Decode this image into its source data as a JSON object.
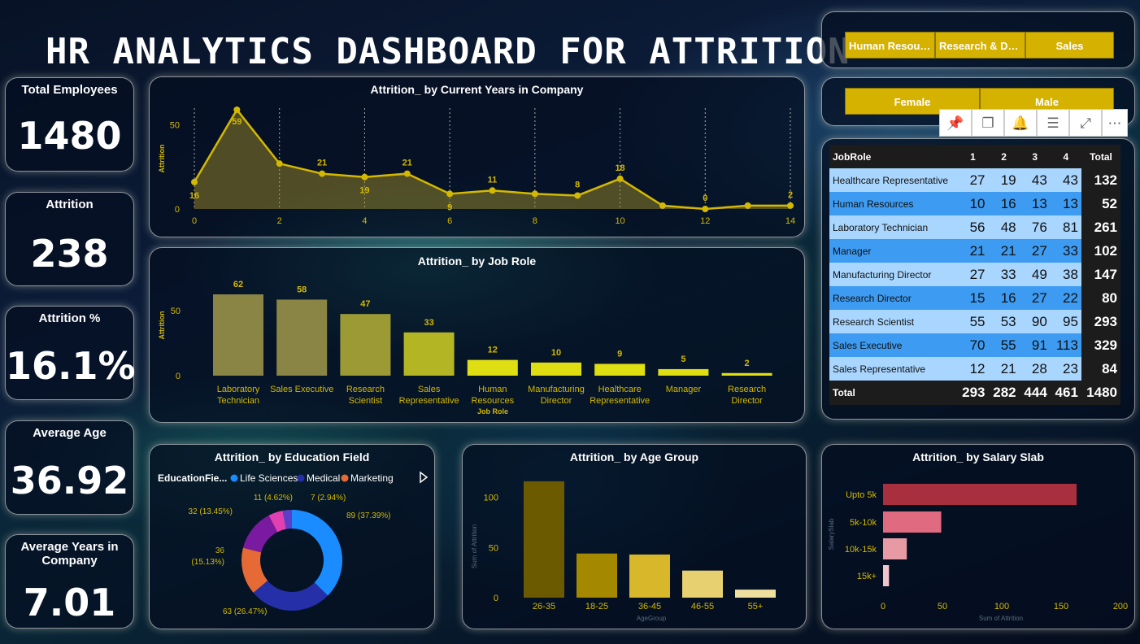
{
  "title": "HR ANALYTICS DASHBOARD FOR ATTRITION",
  "kpis": {
    "total_employees": {
      "label": "Total Employees",
      "value": "1480"
    },
    "attrition": {
      "label": "Attrition",
      "value": "238"
    },
    "attrition_pct": {
      "label": "Attrition %",
      "value": "16.1%"
    },
    "average_age": {
      "label": "Average Age",
      "value": "36.92"
    },
    "average_years": {
      "label": "Average Years in Company",
      "value": "7.01"
    }
  },
  "slicers": {
    "department": [
      "Human Resour...",
      "Research & De...",
      "Sales"
    ],
    "gender": [
      "Female",
      "Male"
    ]
  },
  "toolbar_icons": [
    "pin-icon",
    "copy-icon",
    "bell-icon",
    "filter-icon",
    "expand-icon",
    "more-icon"
  ],
  "colors": {
    "gold": "#d6b200",
    "line": "#d4b800",
    "bar_olive": "#8a8640",
    "bar_yellow": "#dede10",
    "donut_blue": "#1a8cff",
    "donut_navy": "#2530a8",
    "donut_orange": "#e56a35",
    "donut_purple": "#7a1aa0",
    "donut_pink": "#e040b0",
    "salary": "#c03848"
  },
  "matrix": {
    "headers": [
      "JobRole",
      "1",
      "2",
      "3",
      "4",
      "Total"
    ],
    "rows": [
      {
        "role": "Healthcare Representative",
        "v": [
          "27",
          "19",
          "43",
          "43"
        ],
        "total": "132"
      },
      {
        "role": "Human Resources",
        "v": [
          "10",
          "16",
          "13",
          "13"
        ],
        "total": "52"
      },
      {
        "role": "Laboratory Technician",
        "v": [
          "56",
          "48",
          "76",
          "81"
        ],
        "total": "261"
      },
      {
        "role": "Manager",
        "v": [
          "21",
          "21",
          "27",
          "33"
        ],
        "total": "102"
      },
      {
        "role": "Manufacturing Director",
        "v": [
          "27",
          "33",
          "49",
          "38"
        ],
        "total": "147"
      },
      {
        "role": "Research Director",
        "v": [
          "15",
          "16",
          "27",
          "22"
        ],
        "total": "80"
      },
      {
        "role": "Research Scientist",
        "v": [
          "55",
          "53",
          "90",
          "95"
        ],
        "total": "293"
      },
      {
        "role": "Sales Executive",
        "v": [
          "70",
          "55",
          "91",
          "113"
        ],
        "total": "329"
      },
      {
        "role": "Sales Representative",
        "v": [
          "12",
          "21",
          "28",
          "23"
        ],
        "total": "84"
      }
    ],
    "total_row": {
      "label": "Total",
      "v": [
        "293",
        "282",
        "444",
        "461"
      ],
      "total": "1480"
    }
  },
  "chart_data": [
    {
      "id": "years",
      "type": "area",
      "title": "Attrition_ by Current Years in Company",
      "ylabel": "Attrition",
      "x": [
        0,
        1,
        2,
        3,
        4,
        5,
        6,
        7,
        8,
        9,
        10,
        11,
        12,
        13,
        14
      ],
      "values": [
        16,
        59,
        27,
        21,
        19,
        21,
        9,
        11,
        9,
        8,
        18,
        2,
        0,
        2,
        2
      ],
      "data_labels": [
        {
          "i": 0,
          "text": "16"
        },
        {
          "i": 1,
          "text": "59"
        },
        {
          "i": 3,
          "text": "21"
        },
        {
          "i": 4,
          "text": "19"
        },
        {
          "i": 5,
          "text": "21"
        },
        {
          "i": 6,
          "text": "9"
        },
        {
          "i": 7,
          "text": "11"
        },
        {
          "i": 9,
          "text": "8"
        },
        {
          "i": 10,
          "text": "18"
        },
        {
          "i": 12,
          "text": "0"
        },
        {
          "i": 14,
          "text": "2"
        }
      ],
      "x_ticks": [
        "0",
        "2",
        "4",
        "6",
        "8",
        "10",
        "12",
        "14"
      ],
      "y_ticks": [
        "0",
        "50"
      ],
      "ylim": [
        0,
        59
      ]
    },
    {
      "id": "jobrole",
      "type": "bar",
      "title": "Attrition_ by Job Role",
      "ylabel": "Attrition",
      "xlabel": "Job Role",
      "categories": [
        "Laboratory Technician",
        "Sales Executive",
        "Research Scientist",
        "Sales Representative",
        "Human Resources",
        "Manufacturing Director",
        "Healthcare Representative",
        "Manager",
        "Research Director"
      ],
      "values": [
        62,
        58,
        47,
        33,
        12,
        10,
        9,
        5,
        2
      ],
      "y_ticks": [
        "0",
        "50"
      ],
      "ylim": [
        0,
        62
      ]
    },
    {
      "id": "education",
      "type": "pie",
      "title": "Attrition_ by Education Field",
      "legend_title": "EducationFie...",
      "legend": [
        "Life Sciences",
        "Medical",
        "Marketing"
      ],
      "values": [
        89,
        63,
        36,
        32,
        11,
        7
      ],
      "labels": [
        "89 (37.39%)",
        "63 (26.47%)",
        "36 (15.13%)",
        "32 (13.45%)",
        "11 (4.62%)",
        "7 (2.94%)"
      ]
    },
    {
      "id": "age",
      "type": "bar",
      "title": "Attrition_ by Age Group",
      "xlabel": "AgeGroup",
      "ylabel": "Sum of Attrition",
      "categories": [
        "26-35",
        "18-25",
        "36-45",
        "46-55",
        "55+"
      ],
      "values": [
        116,
        44,
        43,
        27,
        8
      ],
      "y_ticks": [
        "0",
        "50",
        "100"
      ],
      "ylim": [
        0,
        120
      ]
    },
    {
      "id": "salary",
      "type": "bar",
      "title": "Attrition_ by Salary Slab",
      "xlabel": "Sum of Attrition",
      "ylabel": "SalarySlab",
      "categories": [
        "Upto 5k",
        "5k-10k",
        "10k-15k",
        "15k+"
      ],
      "values": [
        163,
        49,
        20,
        5
      ],
      "x_ticks": [
        "0",
        "50",
        "100",
        "150",
        "200"
      ],
      "xlim": [
        0,
        200
      ]
    }
  ]
}
